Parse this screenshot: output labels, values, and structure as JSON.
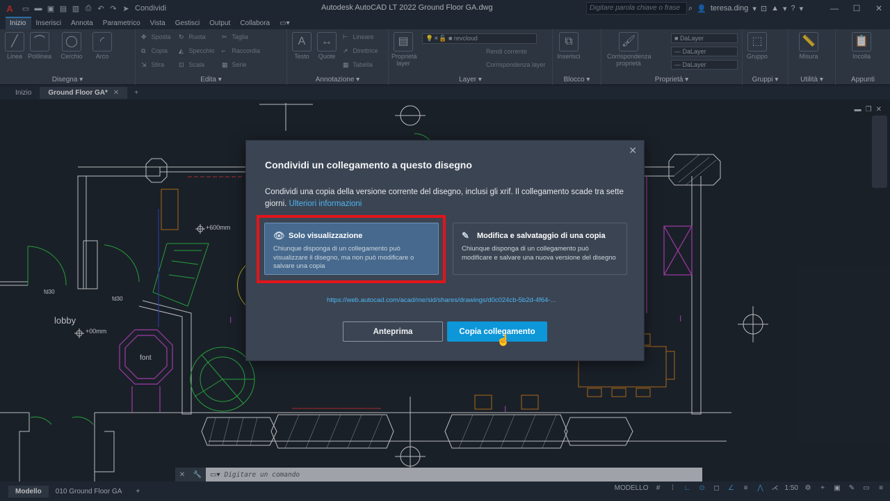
{
  "titlebar": {
    "app_logo": "A",
    "share_label": "Condividi",
    "app_title": "Autodesk AutoCAD LT 2022   Ground Floor  GA.dwg",
    "search_placeholder": "Digitare parola chiave o frase",
    "user_name": "teresa.ding",
    "help": "?"
  },
  "ribbon_tabs": [
    "Inizio",
    "Inserisci",
    "Annota",
    "Parametrico",
    "Vista",
    "Gestisci",
    "Output",
    "Collabora"
  ],
  "ribbon": {
    "disegna": {
      "title": "Disegna",
      "tools": [
        "Linea",
        "Polilinea",
        "Cerchio",
        "Arco"
      ]
    },
    "edita": {
      "title": "Edita",
      "tools": [
        "Sposta",
        "Ruota",
        "Taglia",
        "Copia",
        "Specchio",
        "Raccordia",
        "Stira",
        "Scala",
        "Serie"
      ]
    },
    "annotazione": {
      "title": "Annotazione",
      "tools": [
        "Testo",
        "Quote",
        "Lineare",
        "Direttrice",
        "Tabella"
      ]
    },
    "layer": {
      "title": "Layer",
      "combo": "revcloud",
      "tools": [
        "Proprietà layer",
        "Rendi corrente",
        "Corrispondenza layer"
      ]
    },
    "blocco": {
      "title": "Blocco",
      "tools": [
        "Inserisci"
      ]
    },
    "proprieta": {
      "title": "Proprietà",
      "combos": [
        "DaLayer",
        "DaLayer",
        "DaLayer"
      ],
      "tools": [
        "Corrispondenza proprietà"
      ]
    },
    "gruppi": {
      "title": "Gruppi",
      "tools": [
        "Gruppo"
      ]
    },
    "utilita": {
      "title": "Utilità",
      "tools": [
        "Misura"
      ]
    },
    "appunti": {
      "title": "Appunti",
      "tools": [
        "Incolla"
      ]
    }
  },
  "doc_tabs": [
    {
      "label": "Inizio"
    },
    {
      "label": "Ground Floor  GA*",
      "active": true
    }
  ],
  "drawing": {
    "labels": [
      "lobby",
      "font",
      "fd30",
      "fd30",
      "+600mm",
      "+00mm"
    ]
  },
  "dialog": {
    "title": "Condividi un collegamento a questo disegno",
    "description": "Condividi una copia della versione corrente del disegno, inclusi gli xrif. Il collegamento scade tra sette giorni.",
    "learn_more": "Ulteriori informazioni",
    "option_view": {
      "title": "Solo visualizzazione",
      "desc": "Chiunque disponga di un collegamento può visualizzare il disegno, ma non può modificare o salvare una copia"
    },
    "option_edit": {
      "title": "Modifica e salvataggio di una copia",
      "desc": "Chiunque disponga di un collegamento può modificare e salvare una nuova versione del disegno"
    },
    "share_url": "https://web.autocad.com/acad/me/sid/shares/drawings/d0c024cb-5b2d-4f64-...",
    "preview_button": "Anteprima",
    "copy_button": "Copia collegamento"
  },
  "command_line": {
    "placeholder": "Digitare un comando"
  },
  "statusbar": {
    "layout_tabs": [
      "Modello",
      "010 Ground Floor GA"
    ],
    "mode": "MODELLO",
    "scale": "1:50"
  },
  "colors": {
    "accent": "#0d96d8",
    "highlight": "#e3141b",
    "selected_option": "#46698d"
  }
}
